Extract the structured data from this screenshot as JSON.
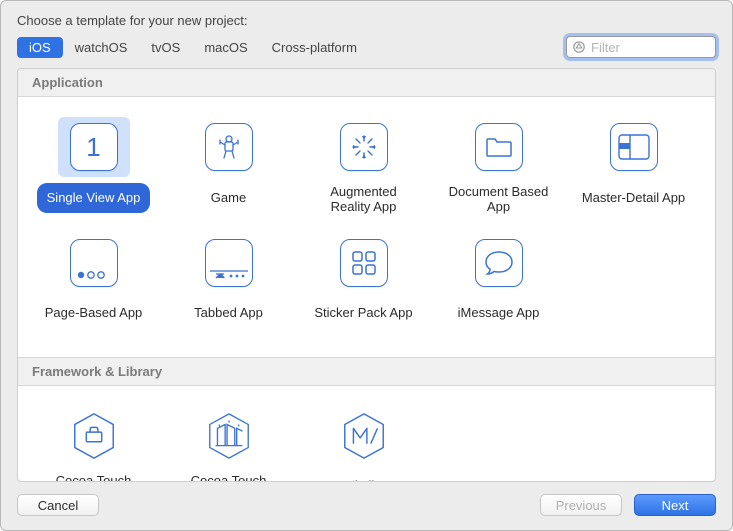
{
  "header": {
    "title": "Choose a template for your new project:"
  },
  "tabs": {
    "items": [
      "iOS",
      "watchOS",
      "tvOS",
      "macOS",
      "Cross-platform"
    ],
    "selected": "iOS"
  },
  "filter": {
    "placeholder": "Filter",
    "value": ""
  },
  "sections": [
    {
      "title": "Application",
      "templates": [
        {
          "label": "Single View App",
          "icon": "single-view",
          "selected": true
        },
        {
          "label": "Game",
          "icon": "game",
          "selected": false
        },
        {
          "label": "Augmented Reality App",
          "icon": "ar",
          "selected": false
        },
        {
          "label": "Document Based App",
          "icon": "document",
          "selected": false
        },
        {
          "label": "Master-Detail App",
          "icon": "master-detail",
          "selected": false
        },
        {
          "label": "Page-Based App",
          "icon": "page-based",
          "selected": false
        },
        {
          "label": "Tabbed App",
          "icon": "tabbed",
          "selected": false
        },
        {
          "label": "Sticker Pack App",
          "icon": "sticker",
          "selected": false
        },
        {
          "label": "iMessage App",
          "icon": "imessage",
          "selected": false
        }
      ]
    },
    {
      "title": "Framework & Library",
      "templates": [
        {
          "label": "Cocoa Touch Framework",
          "icon": "framework",
          "selected": false
        },
        {
          "label": "Cocoa Touch Static Library",
          "icon": "static-lib",
          "selected": false
        },
        {
          "label": "Metal Library",
          "icon": "metal",
          "selected": false
        }
      ]
    }
  ],
  "footer": {
    "cancel": "Cancel",
    "previous": "Previous",
    "next": "Next",
    "previous_enabled": false
  },
  "colors": {
    "accent": "#2f72e4",
    "icon_stroke": "#3a72d8",
    "selection_bg": "#cfe0fb"
  }
}
